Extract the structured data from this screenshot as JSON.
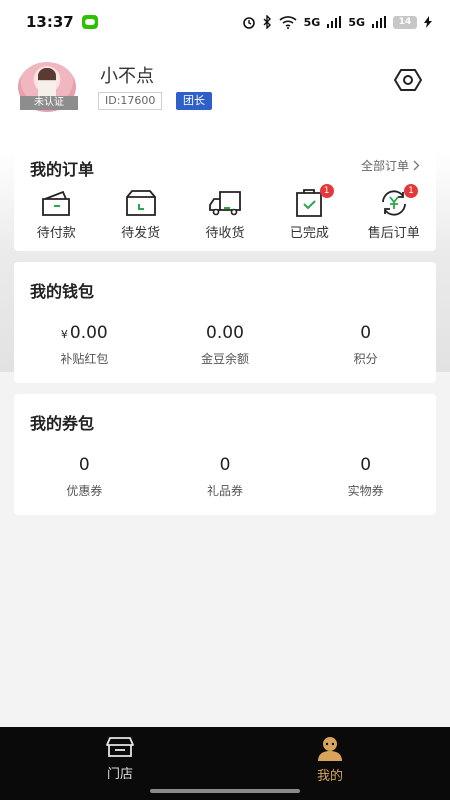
{
  "status_bar": {
    "time": "13:37",
    "network": "5G",
    "battery": "14"
  },
  "profile": {
    "avatar_badge": "未认证",
    "nickname": "小不点",
    "id_text": "ID:17600",
    "role": "团长"
  },
  "orders": {
    "title": "我的订单",
    "all_link": "全部订单",
    "items": [
      {
        "label": "待付款",
        "icon": "wallet-icon"
      },
      {
        "label": "待发货",
        "icon": "box-icon"
      },
      {
        "label": "待收货",
        "icon": "truck-icon"
      },
      {
        "label": "已完成",
        "icon": "clipboard-check-icon",
        "badge": "1"
      },
      {
        "label": "售后订单",
        "icon": "yen-refresh-icon",
        "badge": "1"
      }
    ]
  },
  "wallet": {
    "title": "我的钱包",
    "currency": "¥",
    "stats": [
      {
        "value": "0.00",
        "label": "补贴红包"
      },
      {
        "value": "0.00",
        "label": "金豆余额"
      },
      {
        "value": "0",
        "label": "积分"
      }
    ]
  },
  "coupons": {
    "title": "我的券包",
    "stats": [
      {
        "value": "0",
        "label": "优惠券"
      },
      {
        "value": "0",
        "label": "礼品券"
      },
      {
        "value": "0",
        "label": "实物券"
      }
    ]
  },
  "tabbar": {
    "tabs": [
      {
        "label": "门店",
        "icon": "store-icon"
      },
      {
        "label": "我的",
        "icon": "profile-icon"
      }
    ],
    "active_color": "#d8a35a"
  }
}
